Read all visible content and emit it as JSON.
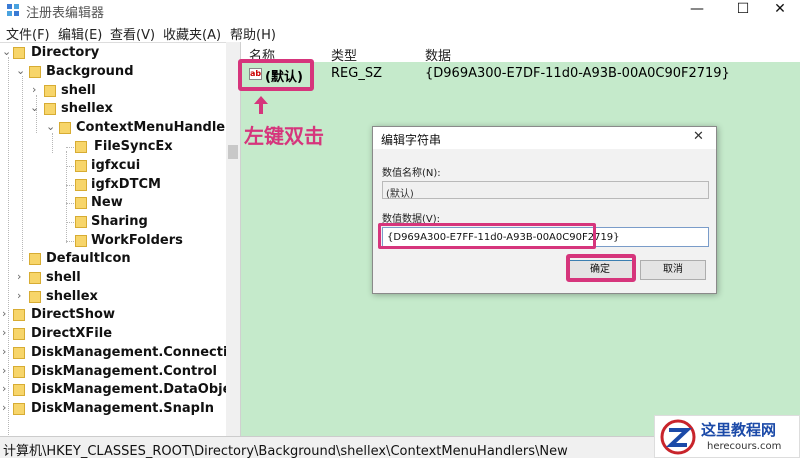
{
  "window": {
    "title": "注册表编辑器",
    "minimize_glyph": "—",
    "maximize_glyph": "☐",
    "close_glyph": "✕"
  },
  "menu": [
    "文件(F)",
    "编辑(E)",
    "查看(V)",
    "收藏夹(A)",
    "帮助(H)"
  ],
  "tree": {
    "items": [
      {
        "label": "Directory",
        "expanded": true
      },
      {
        "label": "Background",
        "expanded": true
      },
      {
        "label": "shell",
        "expanded": false
      },
      {
        "label": "shellex",
        "expanded": true
      },
      {
        "label": "ContextMenuHandlers",
        "expanded": true
      },
      {
        "label": "FileSyncEx"
      },
      {
        "label": "igfxcui"
      },
      {
        "label": "igfxDTCM"
      },
      {
        "label": "New"
      },
      {
        "label": "Sharing"
      },
      {
        "label": "WorkFolders"
      },
      {
        "label": "DefaultIcon"
      },
      {
        "label": "shell",
        "expanded": false
      },
      {
        "label": "shellex",
        "expanded": false
      },
      {
        "label": "DirectShow"
      },
      {
        "label": "DirectXFile"
      },
      {
        "label": "DiskManagement.Connection"
      },
      {
        "label": "DiskManagement.Control"
      },
      {
        "label": "DiskManagement.DataObject"
      },
      {
        "label": "DiskManagement.SnapIn"
      }
    ]
  },
  "values": {
    "headers": [
      "名称",
      "类型",
      "数据"
    ],
    "rows": [
      {
        "name": "(默认)",
        "type": "REG_SZ",
        "data": "{D969A300-E7DF-11d0-A93B-00A0C90F2719}",
        "icon": "ab-string-icon"
      }
    ]
  },
  "annotation": {
    "text": "左键双击",
    "color": "#d6357c"
  },
  "dialog": {
    "title": "编辑字符串",
    "close_glyph": "✕",
    "name_label": "数值名称(N):",
    "name_value": "(默认)",
    "data_label": "数值数据(V):",
    "data_value": "{D969A300-E7FF-11d0-A93B-00A0C90F2719}",
    "ok_label": "确定",
    "cancel_label": "取消"
  },
  "statusbar": {
    "path": "计算机\\HKEY_CLASSES_ROOT\\Directory\\Background\\shellex\\ContextMenuHandlers\\New"
  },
  "watermark": {
    "title": "这里教程网",
    "url": "herecours.com"
  },
  "colors": {
    "highlight": "#d6357c",
    "value_pane_bg": "#c5eacb",
    "folder": "#f7d56a"
  }
}
